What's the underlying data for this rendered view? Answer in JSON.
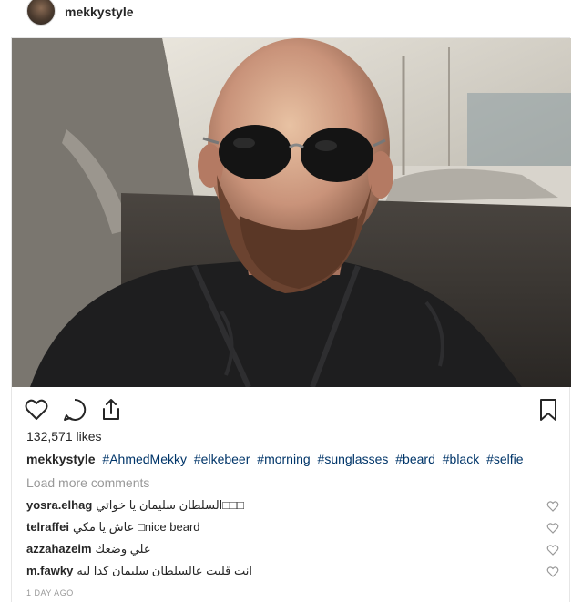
{
  "header": {
    "username": "mekkystyle"
  },
  "post": {
    "likes": "132,571 likes",
    "caption_user": "mekkystyle",
    "hashtags": [
      "#AhmedMekky",
      "#elkebeer",
      "#morning",
      "#sunglasses",
      "#beard",
      "#black",
      "#selfie"
    ],
    "load_more": "Load more comments",
    "comments": [
      {
        "user": "yosra.elhag",
        "text": "السلطان سليمان يا خواتي□□□"
      },
      {
        "user": "telraffei",
        "text": "عاش يا مكي □nice beard"
      },
      {
        "user": "azzahazeim",
        "text": "علي وضعك"
      },
      {
        "user": "m.fawky",
        "text": "انت قلبت عالسلطان سليمان كدا ليه"
      }
    ],
    "time": "1 DAY AGO"
  },
  "icons": {
    "like": "heart-icon",
    "comment": "comment-icon",
    "share": "share-icon",
    "save": "bookmark-icon"
  }
}
